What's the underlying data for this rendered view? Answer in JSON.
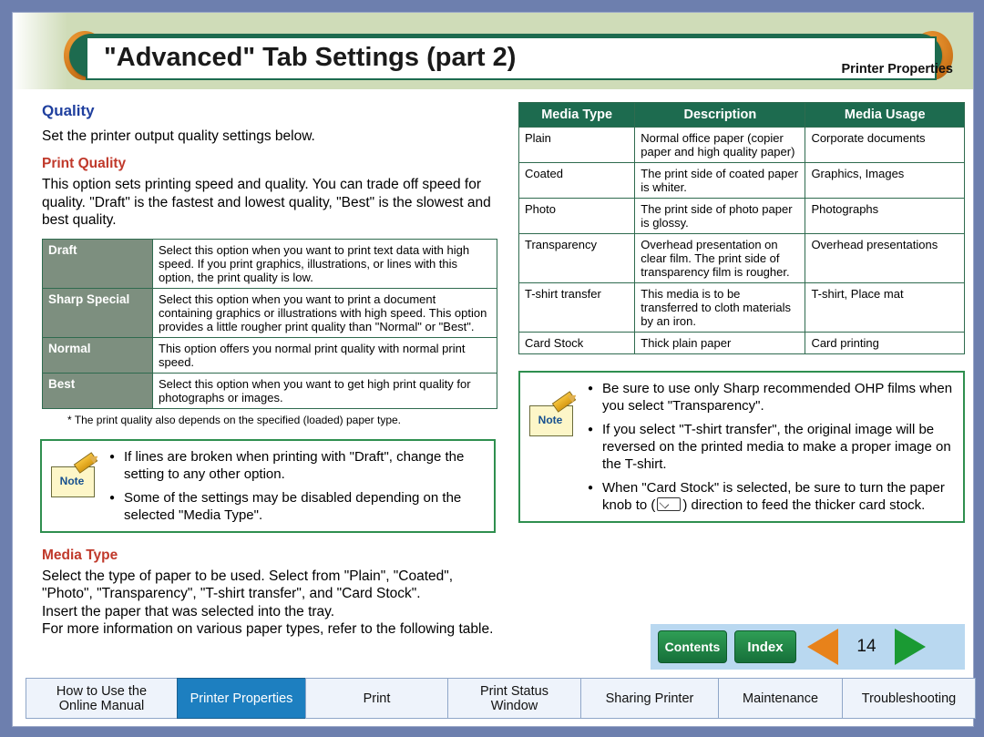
{
  "header": {
    "title": "\"Advanced\" Tab Settings (part 2)",
    "section_label": "Printer Properties"
  },
  "left": {
    "quality_heading": "Quality",
    "quality_intro": "Set the printer output quality settings below.",
    "print_quality_heading": "Print Quality",
    "print_quality_body": "This option sets printing speed and quality. You can trade off speed for quality. \"Draft\" is the fastest and lowest quality, \"Best\" is the slowest and best quality.",
    "quality_table": [
      {
        "label": "Draft",
        "desc": "Select this option when you want to print text data with high speed. If you print graphics, illustrations, or lines with this option, the print quality is low."
      },
      {
        "label": "Sharp Special",
        "desc": "Select this option when you want to print a document containing graphics or illustrations with high speed. This option provides a little rougher print quality than \"Normal\" or \"Best\"."
      },
      {
        "label": "Normal",
        "desc": "This option offers you normal print quality with normal print speed."
      },
      {
        "label": "Best",
        "desc": "Select this option when you want to get high print quality for photographs or images."
      }
    ],
    "table_footnote": "* The print quality also depends on the specified (loaded) paper type.",
    "note_label": "Note",
    "notes": [
      "If lines are broken when printing with \"Draft\", change the setting to any other option.",
      "Some of the settings may be disabled depending on the selected \"Media Type\"."
    ],
    "media_type_heading": "Media Type",
    "media_type_body_1": "Select the type of paper to be used. Select from \"Plain\", \"Coated\", \"Photo\", \"Transparency\", \"T-shirt transfer\", and \"Card Stock\".",
    "media_type_body_2": "Insert the paper that was selected into the tray.",
    "media_type_body_3": "For more information on various paper types, refer to the following table."
  },
  "right": {
    "table_headers": [
      "Media Type",
      "Description",
      "Media Usage"
    ],
    "table_rows": [
      {
        "type": "Plain",
        "description": "Normal office paper (copier paper and high quality paper)",
        "usage": "Corporate documents"
      },
      {
        "type": "Coated",
        "description": "The print side of coated paper is whiter.",
        "usage": "Graphics, Images"
      },
      {
        "type": "Photo",
        "description": "The print side of photo paper is glossy.",
        "usage": "Photographs"
      },
      {
        "type": "Transparency",
        "description": "Overhead presentation on clear film. The print side of transparency film is rougher.",
        "usage": "Overhead presentations"
      },
      {
        "type": "T-shirt transfer",
        "description": "This media is to be transferred to cloth materials by an iron.",
        "usage": "T-shirt, Place mat"
      },
      {
        "type": "Card Stock",
        "description": "Thick plain paper",
        "usage": "Card printing"
      }
    ],
    "note_label": "Note",
    "notes": [
      "Be sure to use only Sharp recommended OHP films when you select \"Transparency\".",
      "If you select \"T-shirt transfer\", the original image will be reversed on the printed media to make a proper image on the T-shirt.",
      "When \"Card Stock\" is selected, be sure to turn the paper knob to (KNOB) direction to feed the thicker card stock."
    ],
    "note_3_part_a": "When \"Card Stock\" is selected, be sure to turn the",
    "note_3_part_b": "paper knob to (",
    "note_3_part_c": ") direction to feed the thicker card",
    "note_3_part_d": "stock."
  },
  "pagenav": {
    "contents_label": "Contents",
    "index_label": "Index",
    "page_number": "14",
    "prev_icon": "left-triangle-icon",
    "next_icon": "right-triangle-icon"
  },
  "footer_nav": [
    {
      "label": "How to Use the\nOnline Manual",
      "line1": "How to Use the",
      "line2": "Online Manual",
      "active": false
    },
    {
      "label": "Printer Properties",
      "line1": "Printer Properties",
      "line2": "",
      "active": true
    },
    {
      "label": "Print",
      "line1": "Print",
      "line2": "",
      "active": false
    },
    {
      "label": "Print Status Window",
      "line1": "Print Status",
      "line2": "Window",
      "active": false
    },
    {
      "label": "Sharing Printer",
      "line1": "Sharing Printer",
      "line2": "",
      "active": false
    },
    {
      "label": "Maintenance",
      "line1": "Maintenance",
      "line2": "",
      "active": false
    },
    {
      "label": "Troubleshooting",
      "line1": "Troubleshooting",
      "line2": "",
      "active": false
    }
  ],
  "colors": {
    "page_bg": "#6d7fae",
    "header_bg": "#cfdcb8",
    "title_green": "#1d6b4f",
    "accent_blue": "#1f3f9e",
    "accent_red": "#c0392b",
    "nav_active": "#1d7fc0"
  }
}
